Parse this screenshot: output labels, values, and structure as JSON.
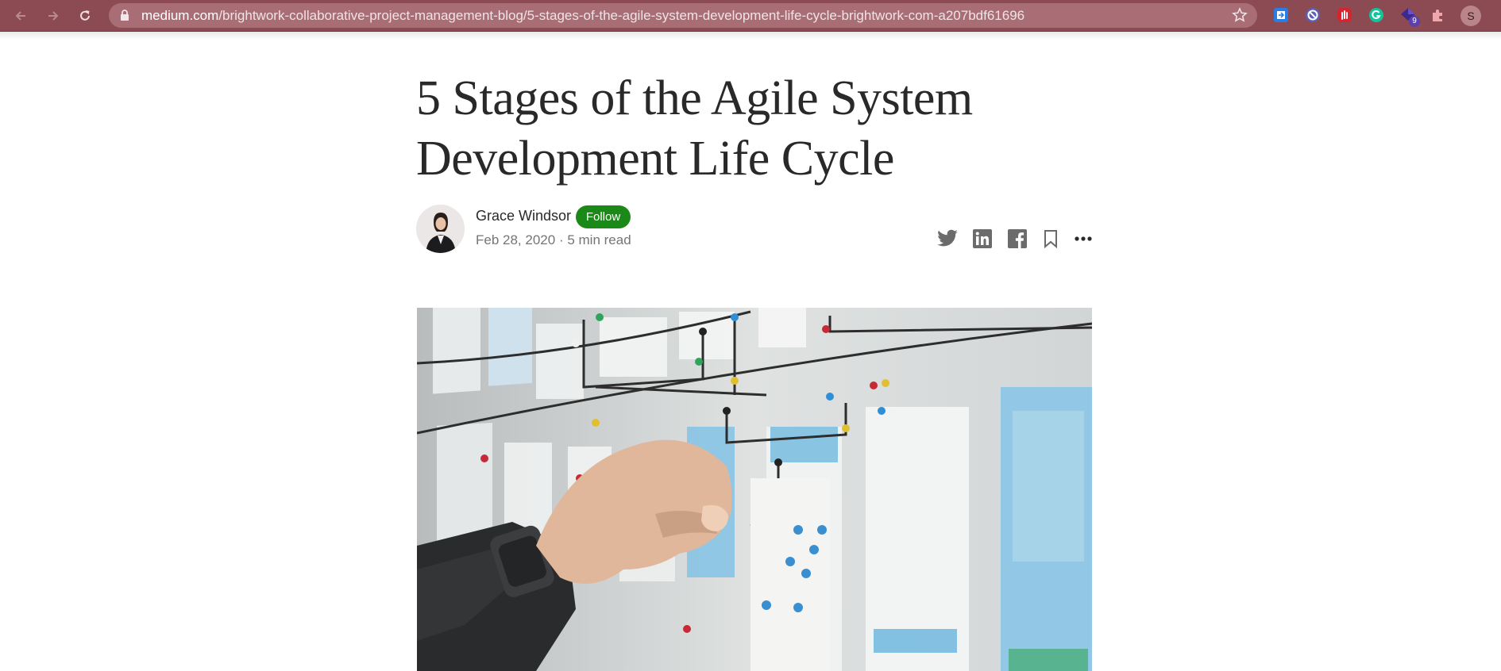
{
  "browser": {
    "url_host": "medium.com",
    "url_path": "/brightwork-collaborative-project-management-blog/5-stages-of-the-agile-system-development-life-cycle-brightwork-com-a207bdf61696",
    "back_icon": "arrow-left-icon",
    "forward_icon": "arrow-right-icon",
    "reload_icon": "reload-icon",
    "extension_badge": "9",
    "profile_initial": "S",
    "toolbar_color": "#8c4a52"
  },
  "article": {
    "title_line1": "5 Stages of the Agile System",
    "title_line2": "Development Life Cycle",
    "author": "Grace Windsor",
    "follow_label": "Follow",
    "date": "Feb 28, 2020",
    "separator": "·",
    "read_time": "5 min read",
    "follow_color": "#1a8917"
  },
  "share": {
    "icons": [
      "twitter-icon",
      "linkedin-icon",
      "facebook-icon",
      "bookmark-icon",
      "more-icon"
    ]
  }
}
